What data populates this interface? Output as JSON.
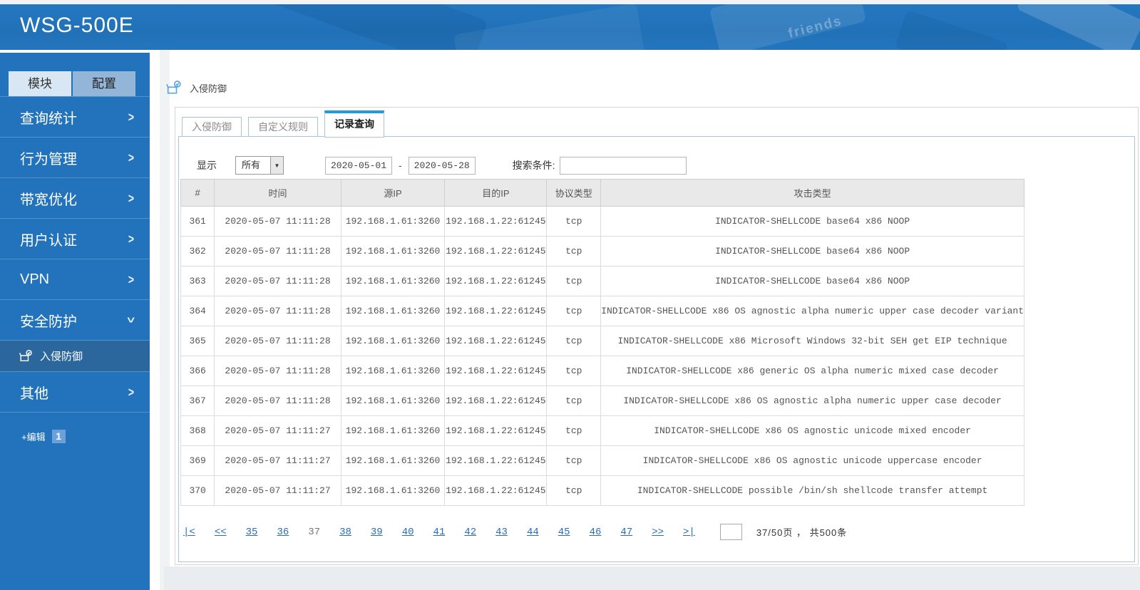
{
  "header": {
    "title": "WSG-500E",
    "key_text": "friends",
    "bg_color": "#2273bb"
  },
  "sidebar": {
    "tabs": [
      {
        "label": "模块",
        "active": true
      },
      {
        "label": "配置",
        "active": false
      }
    ],
    "items": [
      {
        "label": "查询统计"
      },
      {
        "label": "行为管理"
      },
      {
        "label": "带宽优化"
      },
      {
        "label": "用户认证"
      },
      {
        "label": "VPN"
      },
      {
        "label": "安全防护",
        "expanded": true
      },
      {
        "label": "其他"
      }
    ],
    "subitem": {
      "label": "入侵防御",
      "active": true
    },
    "edit": {
      "label": "+编辑",
      "badge": "1"
    }
  },
  "breadcrumb": {
    "label": "入侵防御"
  },
  "content_tabs": [
    {
      "label": "入侵防御",
      "active": false
    },
    {
      "label": "自定义规则",
      "active": false
    },
    {
      "label": "记录查询",
      "active": true
    }
  ],
  "filters": {
    "display_label": "显示",
    "display_value": "所有",
    "date_from": "2020-05-01",
    "date_sep": "-",
    "date_to": "2020-05-28",
    "search_label": "搜索条件:",
    "search_value": ""
  },
  "table": {
    "headers": [
      "#",
      "时间",
      "源IP",
      "目的IP",
      "协议类型",
      "攻击类型"
    ],
    "rows": [
      [
        "361",
        "2020-05-07 11:11:28",
        "192.168.1.61:3260",
        "192.168.1.22:61245",
        "tcp",
        "INDICATOR-SHELLCODE base64 x86 NOOP"
      ],
      [
        "362",
        "2020-05-07 11:11:28",
        "192.168.1.61:3260",
        "192.168.1.22:61245",
        "tcp",
        "INDICATOR-SHELLCODE base64 x86 NOOP"
      ],
      [
        "363",
        "2020-05-07 11:11:28",
        "192.168.1.61:3260",
        "192.168.1.22:61245",
        "tcp",
        "INDICATOR-SHELLCODE base64 x86 NOOP"
      ],
      [
        "364",
        "2020-05-07 11:11:28",
        "192.168.1.61:3260",
        "192.168.1.22:61245",
        "tcp",
        "INDICATOR-SHELLCODE x86 OS agnostic alpha numeric upper case decoder variant"
      ],
      [
        "365",
        "2020-05-07 11:11:28",
        "192.168.1.61:3260",
        "192.168.1.22:61245",
        "tcp",
        "INDICATOR-SHELLCODE x86 Microsoft Windows 32-bit SEH get EIP technique"
      ],
      [
        "366",
        "2020-05-07 11:11:28",
        "192.168.1.61:3260",
        "192.168.1.22:61245",
        "tcp",
        "INDICATOR-SHELLCODE x86 generic OS alpha numeric mixed case decoder"
      ],
      [
        "367",
        "2020-05-07 11:11:28",
        "192.168.1.61:3260",
        "192.168.1.22:61245",
        "tcp",
        "INDICATOR-SHELLCODE x86 OS agnostic alpha numeric upper case decoder"
      ],
      [
        "368",
        "2020-05-07 11:11:27",
        "192.168.1.61:3260",
        "192.168.1.22:61245",
        "tcp",
        "INDICATOR-SHELLCODE x86 OS agnostic unicode mixed encoder"
      ],
      [
        "369",
        "2020-05-07 11:11:27",
        "192.168.1.61:3260",
        "192.168.1.22:61245",
        "tcp",
        "INDICATOR-SHELLCODE x86 OS agnostic unicode uppercase encoder"
      ],
      [
        "370",
        "2020-05-07 11:11:27",
        "192.168.1.61:3260",
        "192.168.1.22:61245",
        "tcp",
        "INDICATOR-SHELLCODE possible /bin/sh shellcode transfer attempt"
      ]
    ]
  },
  "pagination": {
    "first": "|<",
    "prev": "<<",
    "pages": [
      "35",
      "36",
      "37",
      "38",
      "39",
      "40",
      "41",
      "42",
      "43",
      "44",
      "45",
      "46",
      "47"
    ],
    "current": "37",
    "next": ">>",
    "last": ">|",
    "jump_value": "",
    "info": "37/50页 ， 共500条"
  }
}
